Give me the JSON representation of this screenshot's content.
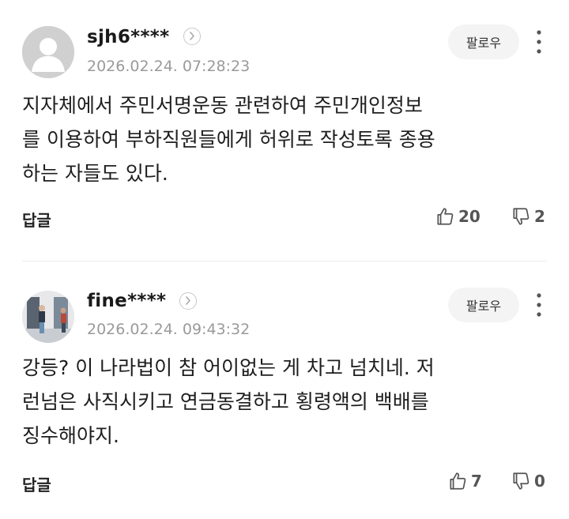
{
  "comments": [
    {
      "username": "sjh6****",
      "timestamp": "2026.02.24. 07:28:23",
      "follow_label": "팔로우",
      "text": "지자체에서 주민서명운동 관련하여 주민개인정보\n를 이용하여 부하직원들에게 허위로 작성토록 종용\n하는 자들도 있다.",
      "reply_label": "답글",
      "likes": "20",
      "dislikes": "2",
      "avatar": "default-person-icon"
    },
    {
      "username": "fine****",
      "timestamp": "2026.02.24. 09:43:32",
      "follow_label": "팔로우",
      "text": "강등? 이 나라법이 참 어이없는 게 차고 넘치네. 저\n런넘은 사직시키고 연금동결하고 횡령액의 백배를\n징수해야지.",
      "reply_label": "답글",
      "likes": "7",
      "dislikes": "0",
      "avatar": "people-photo-avatar"
    }
  ],
  "colors": {
    "background": "#ffffff",
    "text": "#1e1e1e",
    "muted": "#9a9a9a",
    "follow_bg": "#f4f4f4"
  }
}
